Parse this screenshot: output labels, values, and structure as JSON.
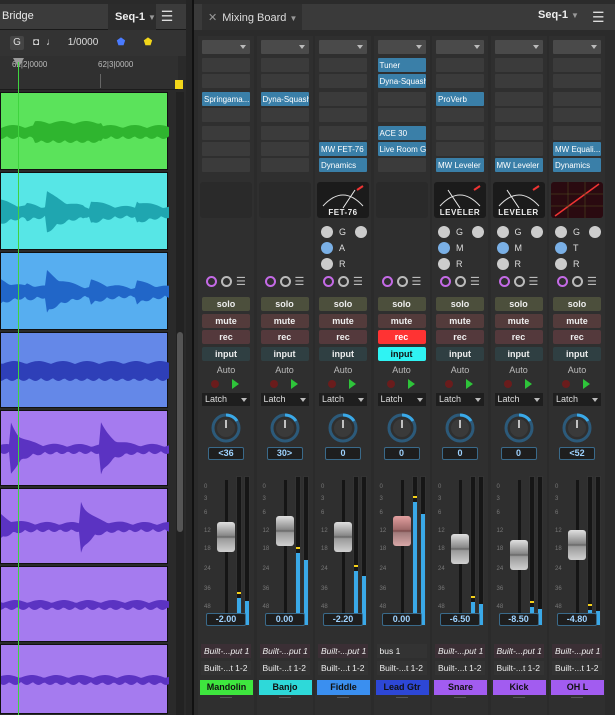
{
  "sequence": {
    "title": "Bridge",
    "seq_tab": "Seq-1",
    "menu_icon": "hamburger-icon",
    "toolbar": [
      "G",
      "1/0000"
    ],
    "ruler": [
      "62|2|0000",
      "62|3|0000"
    ],
    "lanes": [
      {
        "color": "#5be35b",
        "wave": "#2fb52f"
      },
      {
        "color": "#57e6e6",
        "wave": "#1fa6b0"
      },
      {
        "color": "#57aef0",
        "wave": "#2166c8"
      },
      {
        "color": "#6488e8",
        "wave": "#2e3fb8"
      },
      {
        "color": "#a57bef",
        "wave": "#5b33c2"
      },
      {
        "color": "#a57bef",
        "wave": "#5b33c2"
      },
      {
        "color": "#a57bef",
        "wave": "#5b33c2"
      },
      {
        "color": "#a57bef",
        "wave": "#5b33c2"
      }
    ]
  },
  "mixer": {
    "tab": "Mixing Board",
    "seq_tab": "Seq-1",
    "labels": {
      "solo": "solo",
      "mute": "mute",
      "rec": "rec",
      "input": "input",
      "auto": "Auto",
      "latch": "Latch"
    },
    "scale": [
      "0",
      "3",
      "6",
      "12",
      "18",
      "24",
      "36",
      "48"
    ],
    "strips": [
      {
        "name": "Mandolin",
        "name_color": "#3ee63e",
        "inserts_top": [
          "Springama..."
        ],
        "inserts_bottom": [],
        "plugin": "",
        "knobs": null,
        "pan": "<36",
        "volume": "-2.00",
        "io1": "Built-...put 1",
        "io2": "Built-...t 1-2",
        "rec_on": false,
        "input_on": false,
        "level": 0.18,
        "fader": 0.62
      },
      {
        "name": "Banjo",
        "name_color": "#2ed9d9",
        "inserts_top": [
          "Dyna-Squash"
        ],
        "inserts_bottom": [],
        "plugin": "",
        "knobs": null,
        "pan": "30>",
        "volume": "0.00",
        "io1": "Built-...put 1",
        "io2": "Built-...t 1-2",
        "rec_on": false,
        "input_on": false,
        "level": 0.48,
        "fader": 0.67
      },
      {
        "name": "Fiddle",
        "name_color": "#3a8ff0",
        "inserts_top": [],
        "inserts_bottom": [
          "MW FET-76",
          "Dynamics"
        ],
        "plugin": "FET-76",
        "knobs": [
          "G",
          "A",
          "R"
        ],
        "pan": "0",
        "volume": "-2.20",
        "io1": "Built-...put 1",
        "io2": "Built-...t 1-2",
        "rec_on": false,
        "input_on": false,
        "level": 0.36,
        "fader": 0.62
      },
      {
        "name": "Lead Gtr",
        "name_color": "#2d47d6",
        "inserts_top": [
          "Tuner",
          "Dyna-Squash"
        ],
        "inserts_bottom": [
          "ACE 30",
          "Live Room G"
        ],
        "plugin": "",
        "knobs": null,
        "pan": "0",
        "volume": "0.00",
        "io1": "bus 1",
        "io2": "Built-...t 1-2",
        "rec_on": true,
        "input_on": true,
        "level": 0.82,
        "fader": 0.67
      },
      {
        "name": "Snare",
        "name_color": "#a25cf0",
        "inserts_top": [
          "ProVerb"
        ],
        "inserts_bottom": [
          "MW Leveler"
        ],
        "plugin": "LEVELER",
        "knobs": [
          "G",
          "M",
          "R"
        ],
        "pan": "0",
        "volume": "-6.50",
        "io1": "Built-...put 1",
        "io2": "Built-...t 1-2",
        "rec_on": false,
        "input_on": false,
        "level": 0.15,
        "fader": 0.52
      },
      {
        "name": "Kick",
        "name_color": "#a25cf0",
        "inserts_top": [],
        "inserts_bottom": [
          "MW Leveler"
        ],
        "plugin": "LEVELER",
        "knobs": [
          "G",
          "M",
          "R"
        ],
        "pan": "0",
        "volume": "-8.50",
        "io1": "Built-...put 1",
        "io2": "Built-...t 1-2",
        "rec_on": false,
        "input_on": false,
        "level": 0.12,
        "fader": 0.47
      },
      {
        "name": "OH L",
        "name_color": "#a25cf0",
        "inserts_top": [],
        "inserts_bottom": [
          "MW Equali...",
          "Dynamics"
        ],
        "plugin": "",
        "knobs": [
          "G",
          "T",
          "R"
        ],
        "pan": "<52",
        "volume": "-4.80",
        "io1": "Built-...put 1",
        "io2": "Built-...t 1-2",
        "rec_on": false,
        "input_on": false,
        "level": 0.1,
        "fader": 0.55
      }
    ]
  }
}
